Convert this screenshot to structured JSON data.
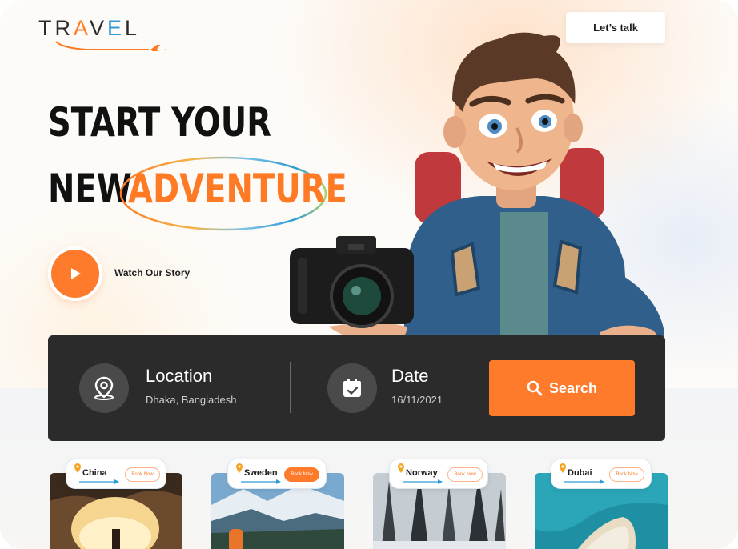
{
  "brand": {
    "logo_letters": [
      "T",
      "R",
      "A",
      "V",
      "E",
      "L"
    ],
    "orange": "#ff7a24",
    "blue": "#2f9bd6"
  },
  "header": {
    "cta_label": "Let’s talk"
  },
  "hero": {
    "line1": "START YOUR",
    "line2_plain": "NEW",
    "line2_highlight": "ADVENTURE",
    "watch_label": "Watch Our Story",
    "character_icon": "traveler-with-camera-illustration"
  },
  "search_bar": {
    "location_title": "Location",
    "location_value": "Dhaka, Bangladesh",
    "location_icon": "map-pin-icon",
    "date_title": "Date",
    "date_value": "16/11/2021",
    "date_icon": "calendar-icon",
    "search_label": "Search",
    "search_icon": "search-icon"
  },
  "destinations": [
    {
      "name": "China",
      "book_label": "Book Now",
      "active": false
    },
    {
      "name": "Sweden",
      "book_label": "Book Now",
      "active": true
    },
    {
      "name": "Norway",
      "book_label": "Book Now",
      "active": false
    },
    {
      "name": "Dubai",
      "book_label": "Book Now",
      "active": false
    }
  ]
}
